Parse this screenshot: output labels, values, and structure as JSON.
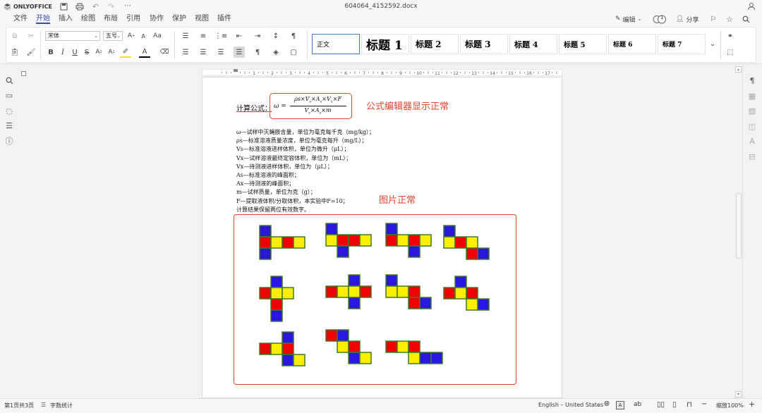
{
  "app": {
    "logo_text": "ONLYOFFICE",
    "document_title": "604064_4152592.docx"
  },
  "menu": {
    "tabs": [
      "文件",
      "开始",
      "插入",
      "绘图",
      "布局",
      "引用",
      "协作",
      "保护",
      "视图",
      "插件"
    ],
    "active": "开始"
  },
  "header_right": {
    "edit_label": "编辑",
    "user_count": "1",
    "share_label": "分享"
  },
  "ribbon": {
    "font_name": "宋体",
    "font_size": "五号",
    "styles": [
      "正文",
      "标题 1",
      "标题 2",
      "标题 3",
      "标题 4",
      "标题 5",
      "标题 6",
      "标题 7"
    ]
  },
  "ruler": {
    "labels": [
      "1",
      "2",
      "3",
      "4",
      "5",
      "6",
      "7",
      "8",
      "9",
      "10",
      "11",
      "12",
      "13",
      "14",
      "15",
      "16",
      "17",
      "18"
    ]
  },
  "document": {
    "formula_label": "计算公式：",
    "formula": {
      "lhs": "ω =",
      "numerator": "ρs×V",
      "num_parts": [
        "ρs×",
        "V",
        "s",
        "×",
        "A",
        "x",
        "×",
        "V",
        "x",
        "×F"
      ],
      "den_parts": [
        "V",
        "x",
        "×",
        "A",
        "s",
        "×",
        "m"
      ]
    },
    "note_formula": "公式编辑器显示正常",
    "note_image": "图片正常",
    "variables": [
      "ω—试样中灭蝇胺含量，单位为毫克每千克（mg/kg）；",
      "ρs—标准溶液质量浓度，单位为毫克每升（mg/L）；",
      "Vs—标准溶液进样体积，单位为微升（μL）；",
      "Vx—试样溶液最终定容体积，单位为（mL）；",
      "Vx—待测液进样体积，单位为（μL）；",
      "As—标准溶液的峰面积；",
      "Ax—待测液的峰面积；",
      "m—试样质量，单位为克（g）；",
      "F—提取液体积/分取体积，本实验中F=10；",
      "计算结果保留两位有效数字。"
    ],
    "cube_colors": {
      "blue": "#2b16e0",
      "red": "#f00000",
      "yellow": "#ffee00",
      "border": "#3f7a28"
    }
  },
  "status": {
    "page_info": "第1页共3页",
    "word_count": "字数统计",
    "language": "English – United States",
    "zoom": "缩放100%"
  },
  "colors": {
    "accent": "#3a4ea8",
    "callout": "#e0452b"
  }
}
